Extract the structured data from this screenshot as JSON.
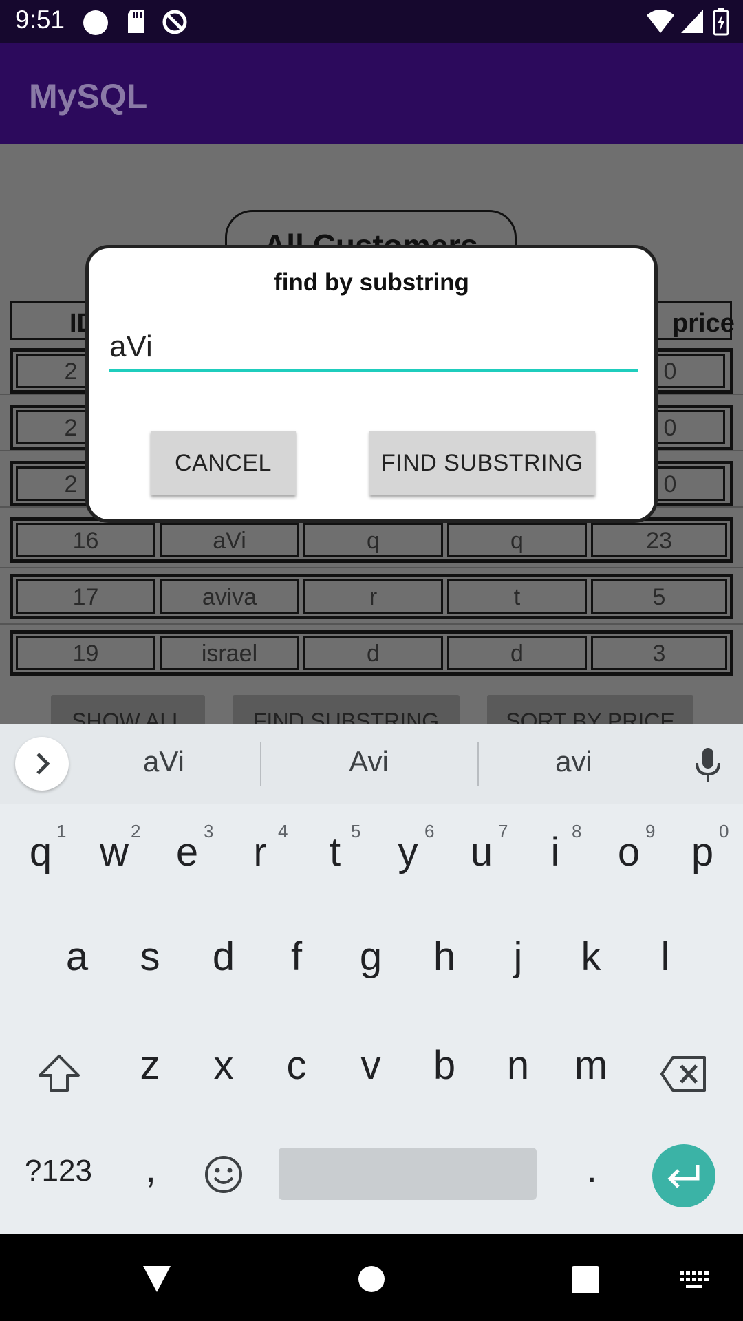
{
  "status_bar": {
    "time": "9:51"
  },
  "app_bar": {
    "title": "MySQL"
  },
  "main": {
    "heading": "All Customers",
    "table": {
      "headers": [
        "ID",
        "price"
      ],
      "rows": [
        [
          "2",
          "",
          "",
          "",
          "0"
        ],
        [
          "2",
          "",
          "",
          "",
          "0"
        ],
        [
          "2",
          "",
          "",
          "",
          "0"
        ],
        [
          "16",
          "aVi",
          "q",
          "q",
          "23"
        ],
        [
          "17",
          "aviva",
          "r",
          "t",
          "5"
        ],
        [
          "19",
          "israel",
          "d",
          "d",
          "3"
        ]
      ]
    },
    "bottom_buttons": [
      "SHOW ALL",
      "FIND SUBSTRING",
      "SORT BY PRICE"
    ]
  },
  "dialog": {
    "title": "find by substring",
    "input_value": "aVi",
    "cancel_label": "CANCEL",
    "confirm_label": "FIND SUBSTRING"
  },
  "keyboard": {
    "suggestions": [
      "aVi",
      "Avi",
      "avi"
    ],
    "row1": [
      "q",
      "w",
      "e",
      "r",
      "t",
      "y",
      "u",
      "i",
      "o",
      "p"
    ],
    "row1_hints": [
      "1",
      "2",
      "3",
      "4",
      "5",
      "6",
      "7",
      "8",
      "9",
      "0"
    ],
    "row2": [
      "a",
      "s",
      "d",
      "f",
      "g",
      "h",
      "j",
      "k",
      "l"
    ],
    "row3": [
      "z",
      "x",
      "c",
      "v",
      "b",
      "n",
      "m"
    ],
    "symbols_label": "?123",
    "comma": ",",
    "period": ".",
    "accent_color": "#3bb3a6"
  },
  "icons": [
    "record-icon",
    "sd-card-icon",
    "sync-off-icon",
    "wifi-icon",
    "signal-icon",
    "battery-icon",
    "chevron-right-icon",
    "microphone-icon",
    "shift-icon",
    "backspace-icon",
    "emoji-icon",
    "enter-icon",
    "back-icon",
    "home-icon",
    "recents-icon",
    "keyboard-switch-icon"
  ]
}
